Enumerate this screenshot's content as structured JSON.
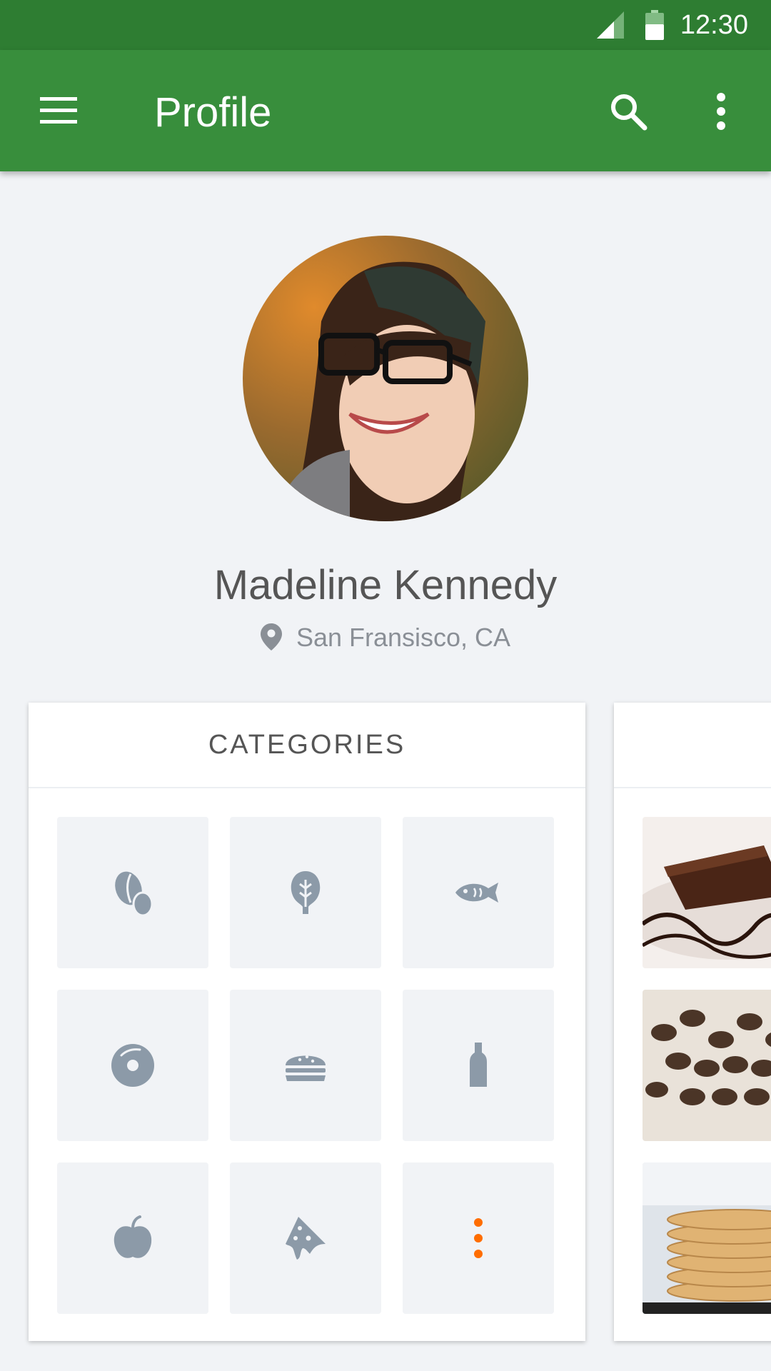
{
  "status_bar": {
    "time": "12:30"
  },
  "app_bar": {
    "title": "Profile"
  },
  "profile": {
    "name": "Madeline Kennedy",
    "location": "San Fransisco, CA"
  },
  "categories_card": {
    "title": "CATEGORIES",
    "tiles": [
      "coffee-beans-icon",
      "spinach-leaf-icon",
      "fish-icon",
      "donut-icon",
      "burger-icon",
      "bottle-icon",
      "apple-icon",
      "pizza-slice-icon",
      "more-icon"
    ]
  },
  "colors": {
    "status_bar": "#2e7d32",
    "app_bar": "#388e3c",
    "icon_gray": "#8c9aa8",
    "accent": "#ff6d00",
    "background": "#f1f3f6"
  }
}
